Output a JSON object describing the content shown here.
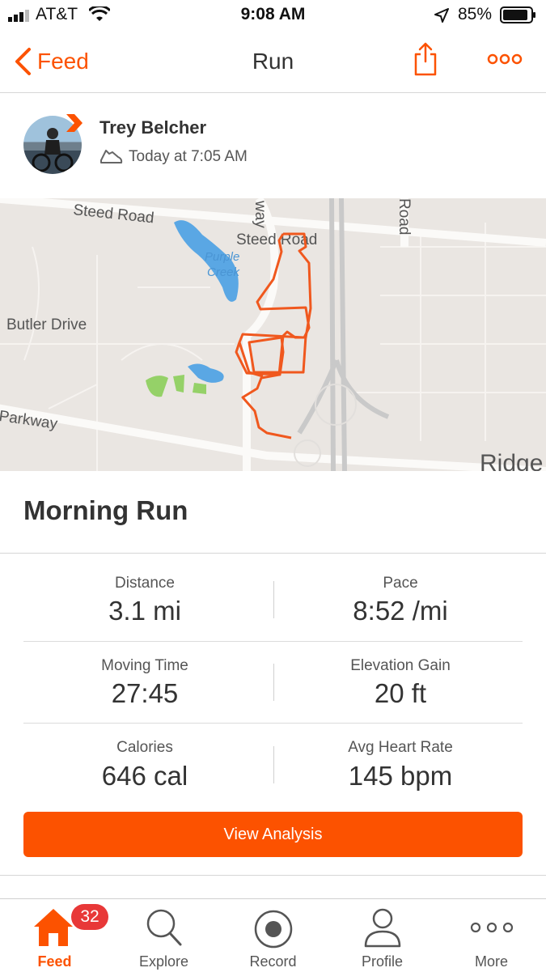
{
  "status_bar": {
    "carrier": "AT&T",
    "time": "9:08 AM",
    "battery": "85%"
  },
  "nav": {
    "back_label": "Feed",
    "title": "Run"
  },
  "athlete": {
    "name": "Trey Belcher",
    "datetime": "Today at 7:05 AM"
  },
  "map": {
    "labels": [
      "Steed Road",
      "Steed Road",
      "Purple",
      "Creek",
      "Butler Drive",
      "Parkway",
      "Road",
      "way",
      "Ridge"
    ]
  },
  "activity": {
    "title": "Morning Run"
  },
  "stats": [
    {
      "label": "Distance",
      "value": "3.1 mi"
    },
    {
      "label": "Pace",
      "value": "8:52 /mi"
    },
    {
      "label": "Moving Time",
      "value": "27:45"
    },
    {
      "label": "Elevation Gain",
      "value": "20 ft"
    },
    {
      "label": "Calories",
      "value": "646 cal"
    },
    {
      "label": "Avg Heart Rate",
      "value": "145 bpm"
    }
  ],
  "view_analysis_label": "View Analysis",
  "tabs": [
    {
      "label": "Feed",
      "icon": "home-icon"
    },
    {
      "label": "Explore",
      "icon": "search-icon"
    },
    {
      "label": "Record",
      "icon": "record-icon"
    },
    {
      "label": "Profile",
      "icon": "person-icon"
    },
    {
      "label": "More",
      "icon": "more-icon"
    }
  ],
  "feed_badge": "32",
  "colors": {
    "accent": "#fc5200",
    "badge": "#e83838",
    "route": "#f0581e"
  }
}
